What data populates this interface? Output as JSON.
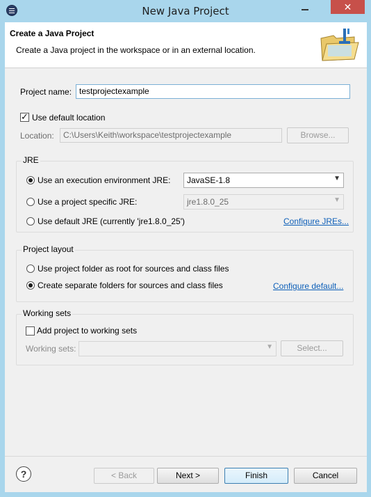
{
  "window": {
    "title": "New Java Project",
    "close_glyph": "✕"
  },
  "banner": {
    "title": "Create a Java Project",
    "description": "Create a Java project in the workspace or in an external location.",
    "icon": "new-java-project-folder-icon"
  },
  "project": {
    "name_label": "Project name:",
    "name_value": "testprojectexample",
    "use_default_location_label": "Use default location",
    "use_default_location_checked": true,
    "location_label": "Location:",
    "location_value": "C:\\Users\\Keith\\workspace\\testprojectexample",
    "browse_label": "Browse..."
  },
  "jre": {
    "group_label": "JRE",
    "options": [
      {
        "label": "Use an execution environment JRE:",
        "selected": true
      },
      {
        "label": "Use a project specific JRE:",
        "selected": false
      },
      {
        "label": "Use default JRE (currently 'jre1.8.0_25')",
        "selected": false
      }
    ],
    "env_value": "JavaSE-1.8",
    "specific_value": "jre1.8.0_25",
    "configure_link": "Configure JREs..."
  },
  "layout": {
    "group_label": "Project layout",
    "options": [
      {
        "label": "Use project folder as root for sources and class files",
        "selected": false
      },
      {
        "label": "Create separate folders for sources and class files",
        "selected": true
      }
    ],
    "configure_link": "Configure default..."
  },
  "working_sets": {
    "group_label": "Working sets",
    "add_label": "Add project to working sets",
    "add_checked": false,
    "sets_label": "Working sets:",
    "sets_value": "",
    "select_label": "Select..."
  },
  "footer": {
    "help_glyph": "?",
    "back_label": "< Back",
    "next_label": "Next >",
    "finish_label": "Finish",
    "cancel_label": "Cancel"
  }
}
